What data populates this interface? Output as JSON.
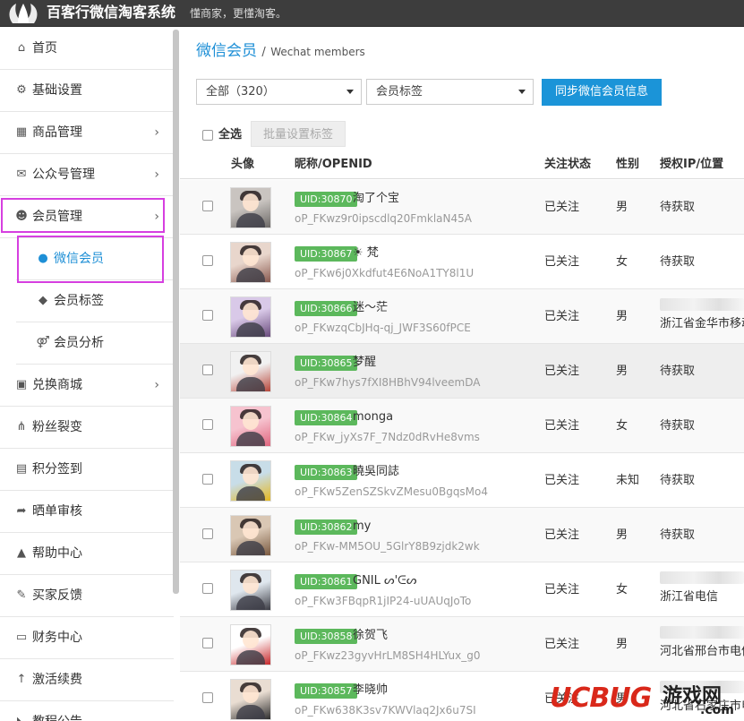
{
  "app": {
    "brand": "百客行微信淘客系统",
    "slogan": "懂商家，更懂淘客。"
  },
  "sidebar": {
    "items": [
      {
        "label": "首页",
        "icon": "home-icon",
        "glyph": "⌂",
        "chevron": ""
      },
      {
        "label": "基础设置",
        "icon": "gear-icon",
        "glyph": "⚙",
        "chevron": ""
      },
      {
        "label": "商品管理",
        "icon": "cubes-icon",
        "glyph": "▦",
        "chevron": "›"
      },
      {
        "label": "公众号管理",
        "icon": "wechat-icon",
        "glyph": "✉",
        "chevron": "›"
      },
      {
        "label": "会员管理",
        "icon": "users-icon",
        "glyph": "☻",
        "chevron": "›"
      },
      {
        "label": "微信会员",
        "icon": "user-icon",
        "glyph": "●",
        "chevron": ""
      },
      {
        "label": "会员标签",
        "icon": "tags-icon",
        "glyph": "◆",
        "chevron": ""
      },
      {
        "label": "会员分析",
        "icon": "gender-icon",
        "glyph": "⚤",
        "chevron": ""
      },
      {
        "label": "兑换商城",
        "icon": "shopping-bag-icon",
        "glyph": "▣",
        "chevron": "›"
      },
      {
        "label": "粉丝裂变",
        "icon": "sitemap-icon",
        "glyph": "⋔",
        "chevron": ""
      },
      {
        "label": "积分签到",
        "icon": "calendar-icon",
        "glyph": "▤",
        "chevron": ""
      },
      {
        "label": "晒单审核",
        "icon": "share-icon",
        "glyph": "➦",
        "chevron": ""
      },
      {
        "label": "帮助中心",
        "icon": "graduation-cap-icon",
        "glyph": "▲",
        "chevron": ""
      },
      {
        "label": "买家反馈",
        "icon": "comments-icon",
        "glyph": "✎",
        "chevron": ""
      },
      {
        "label": "财务中心",
        "icon": "credit-card-icon",
        "glyph": "▭",
        "chevron": ""
      },
      {
        "label": "激活续费",
        "icon": "arrow-up-icon",
        "glyph": "↑",
        "chevron": ""
      },
      {
        "label": "教程公告",
        "icon": "bullhorn-icon",
        "glyph": "◣",
        "chevron": ""
      }
    ]
  },
  "main": {
    "title": "微信会员",
    "title_sep": "/",
    "subtitle": "Wechat members",
    "filter_all": "全部（320）",
    "filter_tag": "会员标签",
    "sync_button": "同步微信会员信息",
    "select_all": "全选",
    "batch_tag_button": "批量设置标签",
    "columns": {
      "avatar": "头像",
      "nickname": "昵称/OPENID",
      "status": "关注状态",
      "gender": "性别",
      "ip": "授权IP/位置"
    },
    "rows": [
      {
        "uid": "UID:30870",
        "nick": "淘了个宝",
        "openid": "oP_FKwz9r0ipscdlq20FmklaN45A",
        "status": "已关注",
        "gender": "男",
        "ip": "待获取",
        "blurred": false,
        "c1": "#c9c4c0",
        "c2": "#6d6a68"
      },
      {
        "uid": "UID:30867",
        "nick": "☀ 梵",
        "openid": "oP_FKw6j0Xkdfut4E6NoA1TY8l1U",
        "status": "已关注",
        "gender": "女",
        "ip": "待获取",
        "blurred": false,
        "c1": "#e8d6cc",
        "c2": "#8a5a50"
      },
      {
        "uid": "UID:30866",
        "nick": "迷～茫",
        "openid": "oP_FKwzqCbJHq-qj_JWF3S60fPCE",
        "status": "已关注",
        "gender": "男",
        "ip": "浙江省金华市移动",
        "blurred": true,
        "c1": "#d9c9e8",
        "c2": "#6a4c7d"
      },
      {
        "uid": "UID:30865",
        "nick": "梦醒",
        "openid": "oP_FKw7hys7fXI8HBhV94lveemDA",
        "status": "已关注",
        "gender": "男",
        "ip": "待获取",
        "blurred": false,
        "c1": "#f1f1f1",
        "c2": "#b7473b"
      },
      {
        "uid": "UID:30864",
        "nick": "monga",
        "openid": "oP_FKw_jyXs7F_7Ndz0dRvHe8vms",
        "status": "已关注",
        "gender": "女",
        "ip": "待获取",
        "blurred": false,
        "c1": "#f6c3cf",
        "c2": "#e0667f"
      },
      {
        "uid": "UID:30863",
        "nick": "曉吳同誌",
        "openid": "oP_FKw5ZenSZSkvZMesu0BgqsMo4",
        "status": "已关注",
        "gender": "未知",
        "ip": "待获取",
        "blurred": false,
        "c1": "#c8dde8",
        "c2": "#e5b820"
      },
      {
        "uid": "UID:30862",
        "nick": "my",
        "openid": "oP_FKw-MM5OU_5GlrY8B9zjdk2wk",
        "status": "已关注",
        "gender": "男",
        "ip": "待获取",
        "blurred": false,
        "c1": "#d9c7b4",
        "c2": "#7a5a40"
      },
      {
        "uid": "UID:30861",
        "nick": "GNIL ᔕ'ᕮᔕ",
        "openid": "oP_FKw3FBqpR1jIP24-uUAUqJoTo",
        "status": "已关注",
        "gender": "女",
        "ip": "浙江省电信",
        "blurred": true,
        "c1": "#dfe7ee",
        "c2": "#3a3a42"
      },
      {
        "uid": "UID:30858",
        "nick": "徐贺飞",
        "openid": "oP_FKwz23gyvHrLM8SH4HLYux_g0",
        "status": "已关注",
        "gender": "男",
        "ip": "河北省邢台市电信",
        "blurred": true,
        "c1": "#ffffff",
        "c2": "#c7282b"
      },
      {
        "uid": "UID:30857",
        "nick": "李晓帅",
        "openid": "oP_FKw638K3sv7KWVlaq2Jx6u7SI",
        "status": "已关注",
        "gender": "男",
        "ip": "河北省石家庄市电信",
        "blurred": true,
        "c1": "#e9ddd2",
        "c2": "#2e2e2e"
      }
    ]
  },
  "watermark": {
    "part1": "UCBUG",
    "part2": "游戏网",
    "part3": ".com"
  },
  "colors": {
    "accent": "#1e8fd6",
    "highlight_box": "#d63fe0",
    "uid_badge": "#5cb85c",
    "topbar": "#3d3d3d"
  }
}
